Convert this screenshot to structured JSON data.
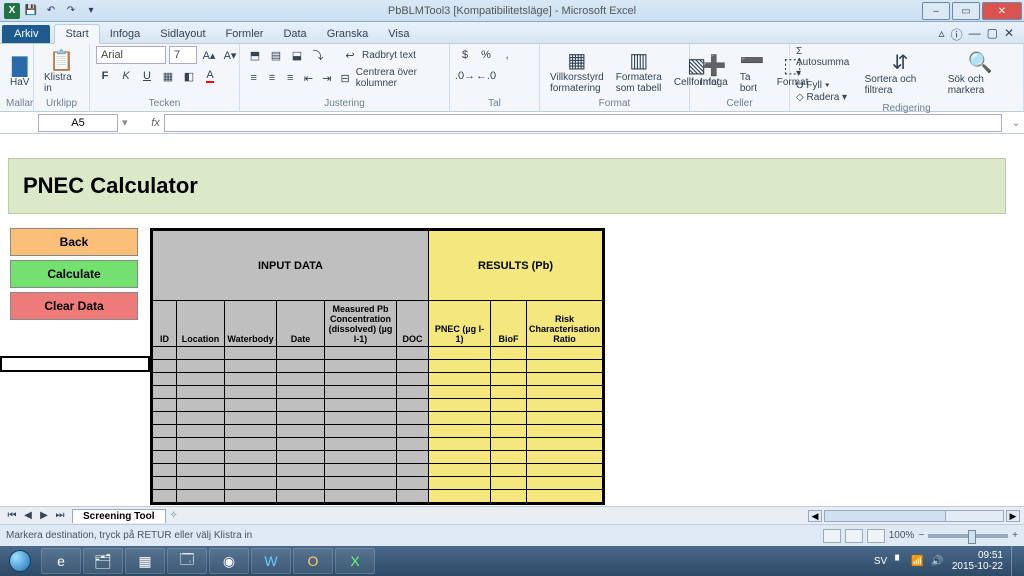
{
  "window": {
    "title": "PbBLMTool3  [Kompatibilitetsläge] - Microsoft Excel",
    "min": "–",
    "max": "▭",
    "close": "✕",
    "help_icon": "ⓘ",
    "min2": "—",
    "max2": "▢",
    "close2": "✕"
  },
  "tabs": {
    "file": "Arkiv",
    "items": [
      "Start",
      "Infoga",
      "Sidlayout",
      "Formler",
      "Data",
      "Granska",
      "Visa"
    ]
  },
  "ribbon": {
    "hav": "HaV",
    "mallar": "Mallar",
    "paste": "Klistra in",
    "clipboard": "Urklipp",
    "font_name": "Arial",
    "font_size": "7",
    "font": "Tecken",
    "align": "Justering",
    "wrap": "Radbryt text",
    "merge": "Centrera över kolumner",
    "number_lbl": "Tal",
    "cond": "Villkorsstyrd formatering",
    "table": "Formatera som tabell",
    "cellstyle": "Cellformat",
    "format_lbl": "Format",
    "insert": "Infoga",
    "delete": "Ta bort",
    "format_cell": "Format",
    "cells_lbl": "Celler",
    "autosum": "Autosumma",
    "fill": "Fyll",
    "clear": "Radera",
    "sort": "Sortera och filtrera",
    "find": "Sök och markera",
    "edit_lbl": "Redigering"
  },
  "formula_bar": {
    "name": "A5",
    "fx": "fx"
  },
  "sheet": {
    "title": "PNEC Calculator",
    "btn_back": "Back",
    "btn_calc": "Calculate",
    "btn_clear": "Clear Data",
    "input_hdr": "INPUT DATA",
    "result_hdr": "RESULTS (Pb)",
    "cols": {
      "id": "ID",
      "location": "Location",
      "waterbody": "Waterbody",
      "date": "Date",
      "measured": "Measured Pb Concentration (dissolved) (µg l-1)",
      "doc": "DOC",
      "pnec": "PNEC (µg l-1)",
      "biof": "BioF",
      "rcr": "Risk Characterisation Ratio"
    }
  },
  "sheettab": {
    "name": "Screening Tool"
  },
  "status": {
    "msg": "Markera destination, tryck på RETUR eller välj Klistra in",
    "zoom": "100%",
    "lang": "SV"
  },
  "taskbar": {
    "time": "09:51",
    "date": "2015-10-22"
  },
  "chart_data": null
}
